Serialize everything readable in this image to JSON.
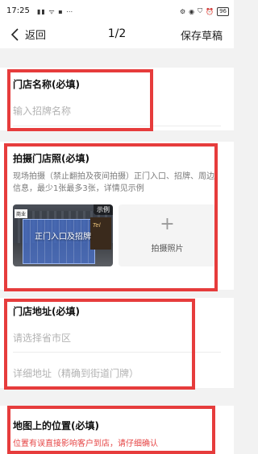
{
  "status_bar": {
    "time": "17:25",
    "battery": "96"
  },
  "nav": {
    "back_label": "返回",
    "page_indicator": "1/2",
    "save_draft_label": "保存草稿"
  },
  "store_name": {
    "label": "门店名称(必填)",
    "placeholder": "输入招牌名称"
  },
  "store_photo": {
    "label": "拍摄门店照(必填)",
    "hint": "现场拍摄（禁止翻拍及夜间拍摄）正门入口、招牌、周边信息，最少1张最多3张，详情见示例",
    "sample": {
      "badge": "示例",
      "caption": "正门入口及招牌",
      "left_sign": "商业",
      "right_sign": "Tel"
    },
    "upload_label": "拍摄照片",
    "upload_icon": "plus-icon"
  },
  "store_address": {
    "label": "门店地址(必填)",
    "region_placeholder": "请选择省市区",
    "detail_placeholder": "详细地址（精确到街道门牌）"
  },
  "map_location": {
    "label": "地图上的位置(必填)",
    "note": "位置有误直接影响客户到店，请仔细确认"
  },
  "colors": {
    "highlight": "#e63c3c",
    "required_note": "#e64545",
    "page_background": "#f2f2f2"
  }
}
